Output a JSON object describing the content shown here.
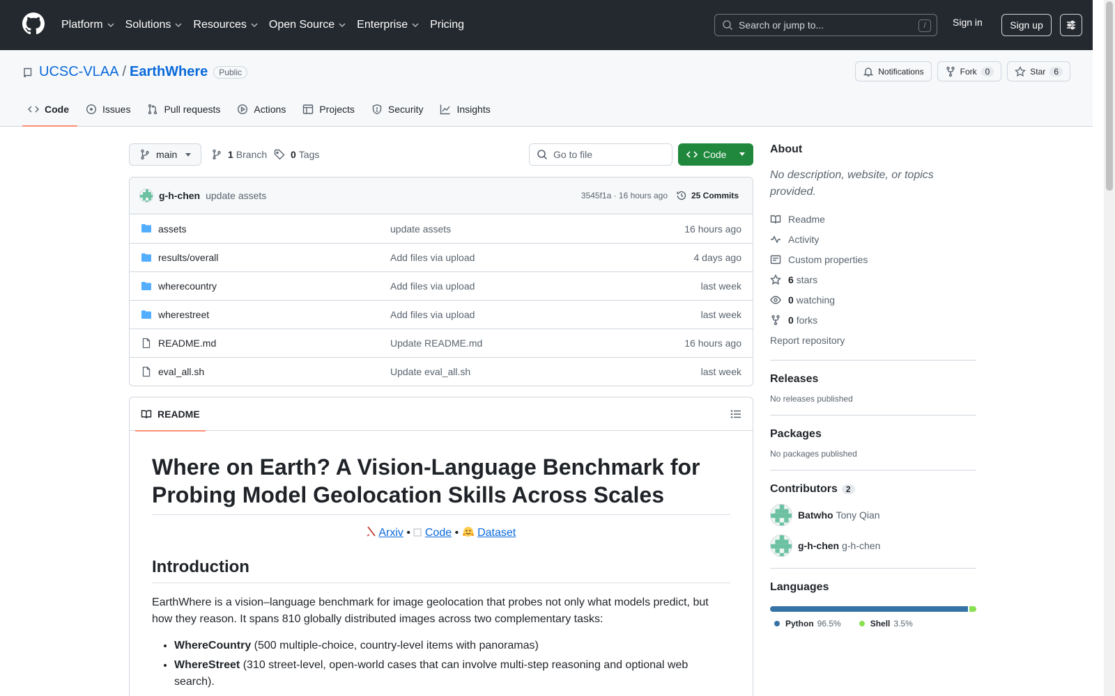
{
  "header": {
    "nav": [
      {
        "label": "Platform",
        "has_menu": true
      },
      {
        "label": "Solutions",
        "has_menu": true
      },
      {
        "label": "Resources",
        "has_menu": true
      },
      {
        "label": "Open Source",
        "has_menu": true
      },
      {
        "label": "Enterprise",
        "has_menu": true
      },
      {
        "label": "Pricing",
        "has_menu": false
      }
    ],
    "search_placeholder": "Search or jump to...",
    "search_key": "/",
    "sign_in": "Sign in",
    "sign_up": "Sign up"
  },
  "repo": {
    "owner": "UCSC-VLAA",
    "separator": "/",
    "name": "EarthWhere",
    "visibility": "Public",
    "actions": {
      "notifications": "Notifications",
      "fork": "Fork",
      "fork_count": "0",
      "star": "Star",
      "star_count": "6"
    },
    "tabs": [
      {
        "label": "Code",
        "icon": "code-icon",
        "active": true
      },
      {
        "label": "Issues",
        "icon": "issue-icon",
        "active": false
      },
      {
        "label": "Pull requests",
        "icon": "pull-request-icon",
        "active": false
      },
      {
        "label": "Actions",
        "icon": "play-icon",
        "active": false
      },
      {
        "label": "Projects",
        "icon": "table-icon",
        "active": false
      },
      {
        "label": "Security",
        "icon": "shield-icon",
        "active": false
      },
      {
        "label": "Insights",
        "icon": "graph-icon",
        "active": false
      }
    ]
  },
  "toolbar": {
    "branch": "main",
    "branch_count": "1",
    "branch_label": "Branch",
    "tag_count": "0",
    "tag_label": "Tags",
    "go_to_file": "Go to file",
    "code_button": "Code"
  },
  "latest_commit": {
    "author": "g-h-chen",
    "message": "update assets",
    "sha_time": "3545f1a · 16 hours ago",
    "commits": "25 Commits"
  },
  "files": [
    {
      "type": "dir",
      "name": "assets",
      "message": "update assets",
      "date": "16 hours ago"
    },
    {
      "type": "dir",
      "name": "results/overall",
      "message": "Add files via upload",
      "date": "4 days ago"
    },
    {
      "type": "dir",
      "name": "wherecountry",
      "message": "Add files via upload",
      "date": "last week"
    },
    {
      "type": "dir",
      "name": "wherestreet",
      "message": "Add files via upload",
      "date": "last week"
    },
    {
      "type": "file",
      "name": "README.md",
      "message": "Update README.md",
      "date": "16 hours ago"
    },
    {
      "type": "file",
      "name": "eval_all.sh",
      "message": "Update eval_all.sh",
      "date": "last week"
    }
  ],
  "readme": {
    "tab": "README",
    "title": "Where on Earth? A Vision-Language Benchmark for Probing Model Geolocation Skills Across Scales",
    "links": {
      "arxiv": "Arxiv",
      "code": "Code",
      "dataset": "Dataset",
      "bullet": "•"
    },
    "intro_heading": "Introduction",
    "intro_text": "EarthWhere is a vision–language benchmark for image geolocation that probes not only what models predict, but how they reason. It spans 810 globally distributed images across two complementary tasks:",
    "bullets": [
      {
        "bold": "WhereCountry",
        "text": " (500 multiple-choice, country-level items with panoramas)"
      },
      {
        "bold": "WhereStreet",
        "text": " (310 street-level, open-world cases that can involve multi-step reasoning and optional web search)."
      }
    ]
  },
  "sidebar": {
    "about_heading": "About",
    "about_desc": "No description, website, or topics provided.",
    "items": [
      {
        "icon": "book-icon",
        "count": "",
        "label": "Readme"
      },
      {
        "icon": "pulse-icon",
        "count": "",
        "label": "Activity"
      },
      {
        "icon": "note-icon",
        "count": "",
        "label": "Custom properties"
      },
      {
        "icon": "star-icon",
        "count": "6",
        "label": "stars"
      },
      {
        "icon": "eye-icon",
        "count": "0",
        "label": "watching"
      },
      {
        "icon": "fork-icon",
        "count": "0",
        "label": "forks"
      }
    ],
    "report": "Report repository",
    "releases_heading": "Releases",
    "releases_text": "No releases published",
    "packages_heading": "Packages",
    "packages_text": "No packages published",
    "contributors_heading": "Contributors",
    "contributors_count": "2",
    "contributors": [
      {
        "login": "Batwho",
        "name": "Tony Qian"
      },
      {
        "login": "g-h-chen",
        "name": "g-h-chen"
      }
    ],
    "languages_heading": "Languages",
    "languages": [
      {
        "name": "Python",
        "percent": "96.5%",
        "value": 96.5,
        "color": "#3572A5"
      },
      {
        "name": "Shell",
        "percent": "3.5%",
        "value": 3.5,
        "color": "#89e051"
      }
    ]
  },
  "colors": {
    "header_bg": "#24292f",
    "link": "#0969da",
    "primary_button": "#1f883d",
    "active_tab_underline": "#fd8c73"
  }
}
